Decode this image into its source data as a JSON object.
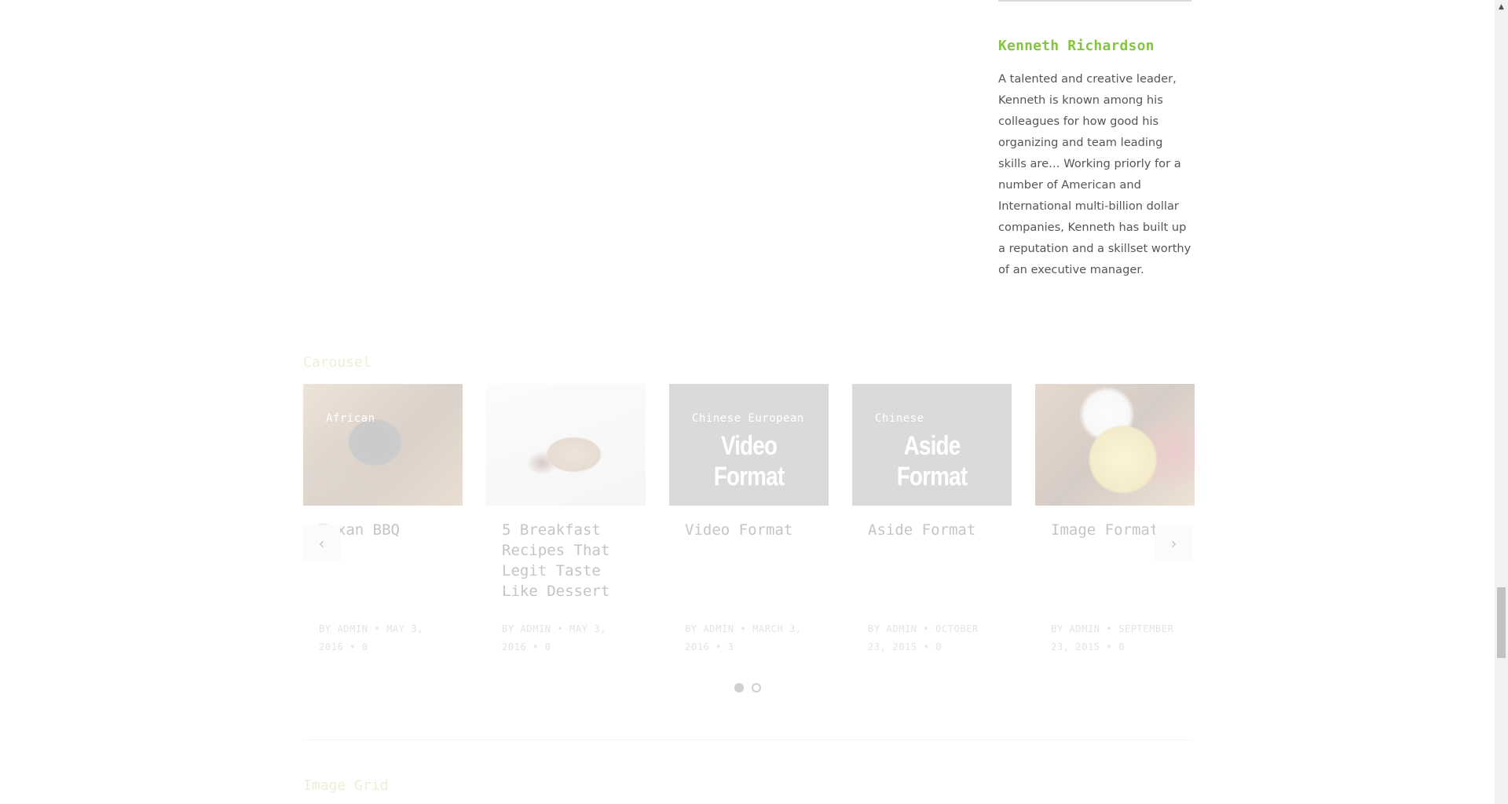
{
  "author": {
    "name": "Kenneth Richardson",
    "bio": "A talented and creative leader, Kenneth is known among his colleagues for how good his organizing and team leading skills are… Working priorly for a number of American and International multi-billion dollar companies, Kenneth has built up a reputation and a skillset worthy of an executive manager."
  },
  "carousel": {
    "title": "Carousel",
    "prev_icon": "chevron-left-icon",
    "next_icon": "chevron-right-icon",
    "prev_glyph": "‹",
    "next_glyph": "›",
    "cards": [
      {
        "category": "African",
        "format": "",
        "title": "Texan BBQ",
        "meta": "BY ADMIN • MAY 3, 2016 • 0"
      },
      {
        "category": "",
        "format": "",
        "title": "5 Breakfast Recipes That Legit Taste Like Dessert",
        "meta": "BY ADMIN • MAY 3, 2016 • 0"
      },
      {
        "category": "Chinese European",
        "format": "Video Format",
        "title": "Video Format",
        "meta": "BY ADMIN • MARCH 3, 2016 • 3"
      },
      {
        "category": "Chinese",
        "format": "Aside Format",
        "title": "Aside Format",
        "meta": "BY ADMIN • OCTOBER 23, 2015 • 0"
      },
      {
        "category": "",
        "format": "",
        "title": "Image Format",
        "meta": "BY ADMIN • SEPTEMBER 23, 2015 • 0"
      }
    ],
    "pages": 2,
    "active_page": 1
  },
  "image_grid": {
    "title": "Image Grid"
  },
  "colors": {
    "accent": "#86c540",
    "section_title": "#b7c96a"
  }
}
